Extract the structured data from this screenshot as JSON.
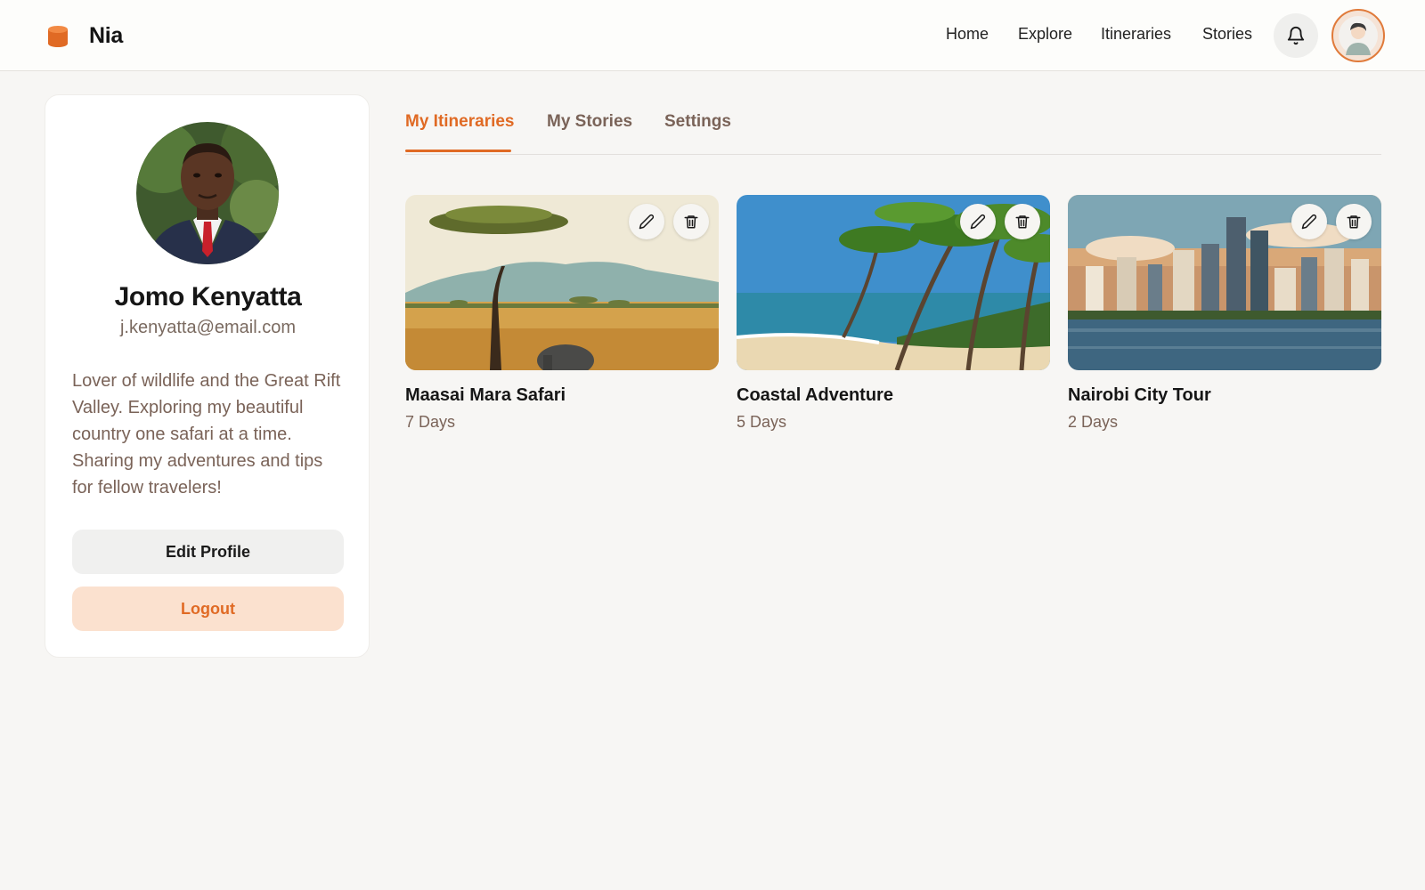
{
  "colors": {
    "accent": "#e06a24",
    "accent_soft": "#fbe1cf",
    "text_muted": "#7a6358"
  },
  "header": {
    "brand": "Nia",
    "brand_icon": "cylinder-logo-icon",
    "nav": {
      "home": "Home",
      "explore": "Explore",
      "itineraries": "Itineraries",
      "stories": "Stories"
    },
    "bell_icon": "bell-icon",
    "avatar_icon": "user-avatar-icon"
  },
  "profile": {
    "name": "Jomo Kenyatta",
    "email": "j.kenyatta@email.com",
    "bio": "Lover of wildlife and the Great Rift Valley. Exploring my beautiful country one safari at a time. Sharing my adventures and tips for fellow travelers!",
    "edit_label": "Edit Profile",
    "logout_label": "Logout"
  },
  "tabs": [
    {
      "label": "My Itineraries",
      "active": true
    },
    {
      "label": "My Stories",
      "active": false
    },
    {
      "label": "Settings",
      "active": false
    }
  ],
  "itineraries": [
    {
      "title": "Maasai Mara Safari",
      "duration": "7 Days",
      "image": "savanna-acacia-elephant"
    },
    {
      "title": "Coastal Adventure",
      "duration": "5 Days",
      "image": "palm-beach"
    },
    {
      "title": "Nairobi City Tour",
      "duration": "2 Days",
      "image": "city-skyline-waterfront"
    }
  ]
}
